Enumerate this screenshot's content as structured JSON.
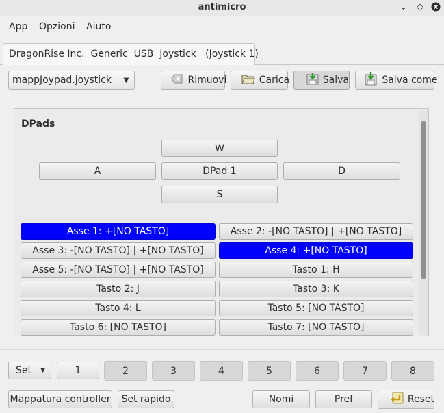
{
  "window": {
    "title": "antimicro"
  },
  "menu": [
    "App",
    "Opzioni",
    "Aiuto"
  ],
  "tab": {
    "label": "DragonRise Inc.  Generic  USB  Joystick   (Joystick 1)"
  },
  "toolbar": {
    "profile_value": "mappJoypad.joystick",
    "remove_label": "Rimuovi",
    "load_label": "Carica",
    "save_label": "Salva",
    "save_as_label": "Salva come"
  },
  "dpad": {
    "section_label": "DPads",
    "up": "W",
    "left": "A",
    "center": "DPad 1",
    "right": "D",
    "down": "S"
  },
  "mappings": {
    "axis1": "Asse 1: +[NO TASTO]",
    "axis2": "Asse 2: -[NO TASTO] | +[NO TASTO]",
    "axis3": "Asse 3: -[NO TASTO] | +[NO TASTO]",
    "axis4": "Asse 4: +[NO TASTO]",
    "axis5": "Asse 5: -[NO TASTO] | +[NO TASTO]",
    "button1": "Tasto 1: H",
    "button2": "Tasto 2: J",
    "button3": "Tasto 3: K",
    "button4": "Tasto 4: L",
    "button5": "Tasto 5: [NO TASTO]",
    "button6": "Tasto 6: [NO TASTO]",
    "button7": "Tasto 7: [NO TASTO]"
  },
  "sets": {
    "label": "Set",
    "items": [
      "1",
      "2",
      "3",
      "4",
      "5",
      "6",
      "7",
      "8"
    ],
    "selected": "1"
  },
  "bottom": {
    "controller_mapping": "Mappatura controller",
    "quick_set": "Set rapido",
    "names": "Nomi",
    "prefs": "Pref",
    "reset": "Reset"
  },
  "colors": {
    "active_mapping": "#0000ff",
    "window_bg": "#efefef"
  },
  "icons": [
    "chevron-down-icon",
    "diamond-icon",
    "close-icon",
    "eraser-icon",
    "folder-icon",
    "save-icon",
    "save-as-icon",
    "reset-icon"
  ]
}
